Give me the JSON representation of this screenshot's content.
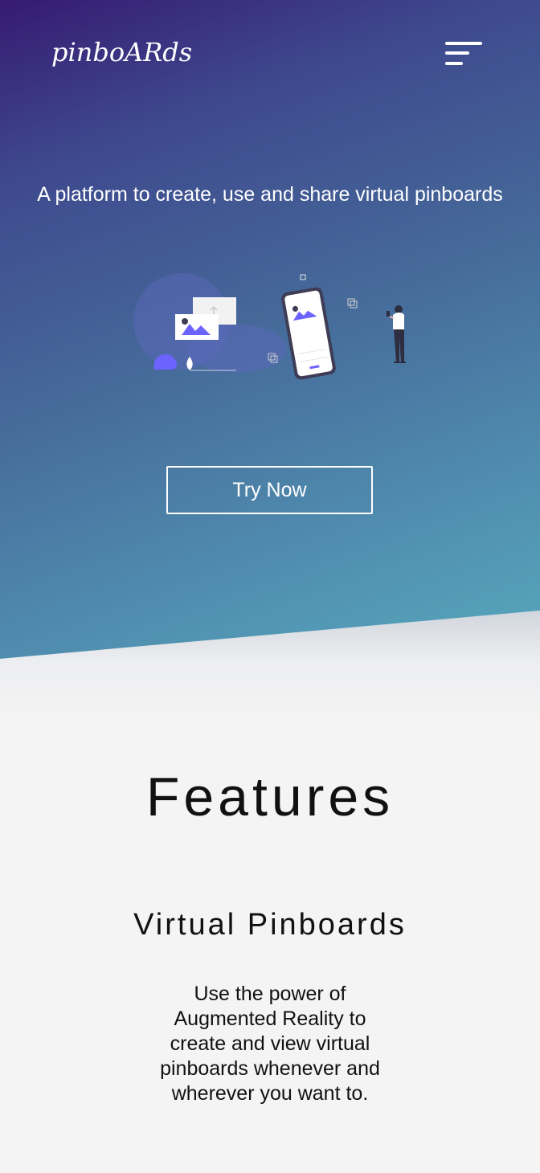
{
  "header": {
    "logo_text": "pinboARds",
    "menu_icon": "hamburger-menu-icon"
  },
  "hero": {
    "tagline": "A platform to create, use and share virtual pinboards",
    "illustration": "phone-ar-illustration",
    "cta_label": "Try Now"
  },
  "features": {
    "title": "Features",
    "items": [
      {
        "heading": "Virtual Pinboards",
        "description": "Use the power of Augmented Reality to create and view virtual pinboards whenever and wherever you want to."
      }
    ]
  },
  "colors": {
    "gradient_start": "#361a72",
    "gradient_mid": "#456899",
    "gradient_end": "#57a8bd",
    "accent_purple": "#6c63ff",
    "background": "#f4f4f4",
    "text": "#111111"
  }
}
